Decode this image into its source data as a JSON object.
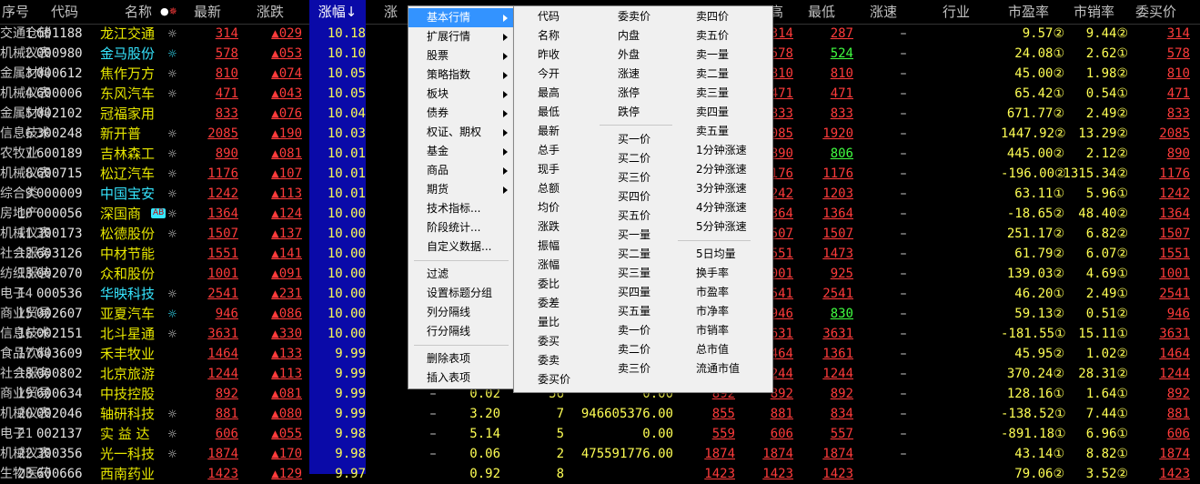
{
  "header": {
    "idx": "序号",
    "code": "代码",
    "name": "名称",
    "latest": "最新",
    "chg": "涨跌",
    "pct": "涨幅↓",
    "cut": "涨",
    "high": "高",
    "low": "最低",
    "speed": "涨速",
    "industry": "行业",
    "pe": "市盈率",
    "ps": "市销率",
    "bid": "委买价"
  },
  "rows": [
    {
      "idx": "1",
      "code": "601188",
      "name": "龙江交通",
      "star": "☼",
      "latest": "314",
      "chg": "▲029",
      "pct": "10.18",
      "open": "",
      "high": "314",
      "low": "287",
      "speed": "–",
      "industry": "交通仓储",
      "pe": "9.57②",
      "ps": "9.44②",
      "bid": "314"
    },
    {
      "idx": "2",
      "code": "000980",
      "name": "金马股份",
      "star": "☼",
      "latest": "578",
      "chg": "▲053",
      "pct": "10.10",
      "open": "",
      "high": "578",
      "low": "524",
      "speed": "–",
      "industry": "机械仪表",
      "pe": "24.08①",
      "ps": "2.62①",
      "bid": "578"
    },
    {
      "idx": "3",
      "code": "000612",
      "name": "焦作万方",
      "star": "☼",
      "latest": "810",
      "chg": "▲074",
      "pct": "10.05",
      "open": "",
      "high": "810",
      "low": "810",
      "speed": "–",
      "industry": "金属材料",
      "pe": "45.00②",
      "ps": "1.98②",
      "bid": "810"
    },
    {
      "idx": "4",
      "code": "600006",
      "name": "东风汽车",
      "star": "☼",
      "latest": "471",
      "chg": "▲043",
      "pct": "10.05",
      "open": "",
      "high": "471",
      "low": "471",
      "speed": "–",
      "industry": "机械仪表",
      "pe": "65.42①",
      "ps": "0.54①",
      "bid": "471"
    },
    {
      "idx": "5",
      "code": "002102",
      "name": "冠福家用",
      "star": "",
      "latest": "833",
      "chg": "▲076",
      "pct": "10.04",
      "open": "",
      "high": "833",
      "low": "833",
      "speed": "–",
      "industry": "金属材料",
      "pe": "671.77②",
      "ps": "2.49②",
      "bid": "833"
    },
    {
      "idx": "6",
      "code": "300248",
      "name": "新开普",
      "star": "☼",
      "latest": "2085",
      "chg": "▲190",
      "pct": "10.03",
      "open": "",
      "high": "085",
      "low": "1920",
      "speed": "–",
      "industry": "信息技术",
      "pe": "1447.92②",
      "ps": "13.29②",
      "bid": "2085"
    },
    {
      "idx": "7",
      "code": "600189",
      "name": "吉林森工",
      "star": "☼",
      "latest": "890",
      "chg": "▲081",
      "pct": "10.01",
      "open": "",
      "high": "890",
      "low": "806",
      "speed": "–",
      "industry": "农牧业",
      "pe": "445.00②",
      "ps": "2.12②",
      "bid": "890"
    },
    {
      "idx": "8",
      "code": "600715",
      "name": "松辽汽车",
      "star": "☼",
      "latest": "1176",
      "chg": "▲107",
      "pct": "10.01",
      "open": "",
      "high": "176",
      "low": "1176",
      "speed": "–",
      "industry": "机械仪表",
      "pe": "-196.00②",
      "ps": "1315.34②",
      "bid": "1176"
    },
    {
      "idx": "9",
      "code": "000009",
      "name": "中国宝安",
      "star": "☼",
      "latest": "1242",
      "chg": "▲113",
      "pct": "10.01",
      "open": "",
      "high": "242",
      "low": "1203",
      "speed": "–",
      "industry": "综合类",
      "pe": "63.11①",
      "ps": "5.96①",
      "bid": "1242"
    },
    {
      "idx": "10",
      "code": "000056",
      "name": "深国商",
      "star": "☼",
      "badge": "AB",
      "latest": "1364",
      "chg": "▲124",
      "pct": "10.00",
      "open": "",
      "high": "364",
      "low": "1364",
      "speed": "–",
      "industry": "房地产",
      "pe": "-18.65②",
      "ps": "48.40②",
      "bid": "1364"
    },
    {
      "idx": "11",
      "code": "300173",
      "name": "松德股份",
      "star": "☼",
      "latest": "1507",
      "chg": "▲137",
      "pct": "10.00",
      "open": "",
      "high": "507",
      "low": "1507",
      "speed": "–",
      "industry": "机械仪表",
      "pe": "251.17②",
      "ps": "6.82②",
      "bid": "1507"
    },
    {
      "idx": "12",
      "code": "603126",
      "name": "中材节能",
      "star": "",
      "latest": "1551",
      "chg": "▲141",
      "pct": "10.00",
      "open": "",
      "high": "551",
      "low": "1473",
      "speed": "–",
      "industry": "社会服务",
      "pe": "61.79②",
      "ps": "6.07②",
      "bid": "1551"
    },
    {
      "idx": "13",
      "code": "002070",
      "name": "众和股份",
      "star": "",
      "latest": "1001",
      "chg": "▲091",
      "pct": "10.00",
      "open": "",
      "high": "001",
      "low": "925",
      "speed": "–",
      "industry": "纺织服装",
      "pe": "139.03②",
      "ps": "4.69①",
      "bid": "1001"
    },
    {
      "idx": "14",
      "code": "000536",
      "name": "华映科技",
      "star": "☼",
      "latest": "2541",
      "chg": "▲231",
      "pct": "10.00",
      "open": "",
      "high": "541",
      "low": "2541",
      "speed": "–",
      "industry": "电子",
      "pe": "46.20①",
      "ps": "2.49①",
      "bid": "2541"
    },
    {
      "idx": "15",
      "code": "002607",
      "name": "亚夏汽车",
      "star": "☼",
      "latest": "946",
      "chg": "▲086",
      "pct": "10.00",
      "open": "",
      "high": "946",
      "low": "830",
      "speed": "–",
      "industry": "商业贸易",
      "pe": "59.13②",
      "ps": "0.51②",
      "bid": "946"
    },
    {
      "idx": "16",
      "code": "002151",
      "name": "北斗星通",
      "star": "☼",
      "latest": "3631",
      "chg": "▲330",
      "pct": "10.00",
      "open": "",
      "high": "631",
      "low": "3631",
      "speed": "–",
      "industry": "信息技术",
      "pe": "-181.55①",
      "ps": "15.11①",
      "bid": "3631"
    },
    {
      "idx": "17",
      "code": "603609",
      "name": "禾丰牧业",
      "star": "",
      "latest": "1464",
      "chg": "▲133",
      "pct": "9.99",
      "open": "",
      "high": "464",
      "low": "1361",
      "speed": "–",
      "industry": "食品饮料",
      "pe": "45.95②",
      "ps": "1.02②",
      "bid": "1464"
    },
    {
      "idx": "18",
      "code": "000802",
      "name": "北京旅游",
      "star": "",
      "latest": "1244",
      "chg": "▲113",
      "pct": "9.99",
      "open": "",
      "high": "244",
      "low": "1244",
      "speed": "–",
      "industry": "社会服务",
      "pe": "370.24②",
      "ps": "28.31②",
      "bid": "1244"
    },
    {
      "idx": "19",
      "code": "600634",
      "name": "中技控股",
      "star": "",
      "latest": "892",
      "chg": "▲081",
      "pct": "9.99",
      "dash": "–",
      "vol1": "0.02",
      "vol2": "56",
      "amt": "0.00",
      "open": "892",
      "high": "892",
      "low": "892",
      "speed": "–",
      "industry": "商业贸易",
      "pe": "128.16①",
      "ps": "1.64①",
      "bid": "892"
    },
    {
      "idx": "20",
      "code": "002046",
      "name": "轴研科技",
      "star": "☼",
      "latest": "881",
      "chg": "▲080",
      "pct": "9.99",
      "dash": "–",
      "vol1": "3.20",
      "vol2": "7",
      "amt": "946605376.00",
      "open": "855",
      "high": "881",
      "low": "834",
      "speed": "–",
      "industry": "机械仪表",
      "pe": "-138.52①",
      "ps": "7.44①",
      "bid": "881"
    },
    {
      "idx": "21",
      "code": "002137",
      "name": "实 益 达",
      "star": "☼",
      "latest": "606",
      "chg": "▲055",
      "pct": "9.98",
      "dash": "–",
      "vol1": "5.14",
      "vol2": "5",
      "amt": "0.00",
      "open": "559",
      "high": "606",
      "low": "557",
      "speed": "–",
      "industry": "电子",
      "pe": "-891.18①",
      "ps": "6.96①",
      "bid": "606"
    },
    {
      "idx": "22",
      "code": "300356",
      "name": "光一科技",
      "star": "☼",
      "latest": "1874",
      "chg": "▲170",
      "pct": "9.98",
      "dash": "–",
      "vol1": "0.06",
      "vol2": "2",
      "amt": "475591776.00",
      "open": "1874",
      "high": "1874",
      "low": "1874",
      "speed": "–",
      "industry": "机械仪表",
      "pe": "43.14①",
      "ps": "8.82①",
      "bid": "1874"
    },
    {
      "idx": "23",
      "code": "600666",
      "name": "西南药业",
      "star": "",
      "latest": "1423",
      "chg": "▲129",
      "pct": "9.97",
      "dash": "",
      "vol1": "0.92",
      "vol2": "8",
      "amt": "",
      "open": "1423",
      "high": "1423",
      "low": "1423",
      "speed": "",
      "industry": "生物医药",
      "pe": "79.06②",
      "ps": "3.52②",
      "bid": "1423"
    }
  ],
  "menu": [
    {
      "label": "基本行情",
      "arrow": true,
      "active": true
    },
    {
      "label": "扩展行情",
      "arrow": true
    },
    {
      "label": "股票",
      "arrow": true
    },
    {
      "label": "策略指数",
      "arrow": true
    },
    {
      "label": "板块",
      "arrow": true
    },
    {
      "label": "债券",
      "arrow": true
    },
    {
      "label": "权证、期权",
      "arrow": true
    },
    {
      "label": "基金",
      "arrow": true
    },
    {
      "label": "商品",
      "arrow": true
    },
    {
      "label": "期货",
      "arrow": true
    },
    {
      "label": "技术指标..."
    },
    {
      "label": "阶段统计..."
    },
    {
      "label": "自定义数据..."
    },
    {
      "sep": true
    },
    {
      "label": "过滤"
    },
    {
      "label": "设置标题分组"
    },
    {
      "label": "列分隔线"
    },
    {
      "label": "行分隔线"
    },
    {
      "sep": true
    },
    {
      "label": "删除表项"
    },
    {
      "label": "插入表项"
    }
  ],
  "submenu": {
    "col1": [
      "代码",
      "名称",
      "昨收",
      "今开",
      "最高",
      "最低",
      "最新",
      "总手",
      "现手",
      "总额",
      "均价",
      "涨跌",
      "振幅",
      "涨幅",
      "委比",
      "委差",
      "量比",
      "委买",
      "委卖",
      "委买价"
    ],
    "col2a": [
      "委卖价",
      "内盘",
      "外盘",
      "涨速",
      "涨停",
      "跌停"
    ],
    "col2b": [
      "买一价",
      "买二价",
      "买三价",
      "买四价",
      "买五价",
      "买一量",
      "买二量",
      "买三量",
      "买四量",
      "买五量",
      "卖一价",
      "卖二价",
      "卖三价"
    ],
    "col3a": [
      "卖四价",
      "卖五价",
      "卖一量",
      "卖二量",
      "卖三量",
      "卖四量",
      "卖五量",
      "1分钟涨速",
      "2分钟涨速",
      "3分钟涨速",
      "4分钟涨速",
      "5分钟涨速"
    ],
    "col3b": [
      "5日均量",
      "换手率",
      "市盈率",
      "市净率",
      "市销率",
      "总市值",
      "流通市值"
    ]
  },
  "colors": {
    "up": "#ff3b3b",
    "yellow": "#ffff54",
    "cyan": "#36e6ff",
    "green": "#40ff40",
    "highlight": "#0a0aa8",
    "menu_active": "#3393ff"
  }
}
